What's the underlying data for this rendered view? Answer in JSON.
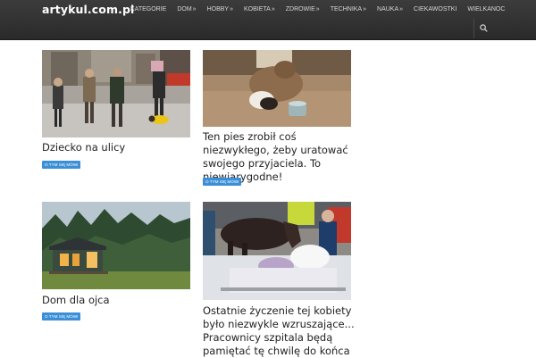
{
  "site": {
    "logo": "artykul.com.pl"
  },
  "nav": [
    {
      "label": "Kategorie",
      "chevron": false
    },
    {
      "label": "Dom",
      "chevron": true
    },
    {
      "label": "Hobby",
      "chevron": true
    },
    {
      "label": "Kobieta",
      "chevron": true
    },
    {
      "label": "Zdrowie",
      "chevron": true
    },
    {
      "label": "Technika",
      "chevron": true
    },
    {
      "label": "Nauka",
      "chevron": true
    },
    {
      "label": "Ciekawostki",
      "chevron": false
    },
    {
      "label": "Wielkanoc",
      "chevron": false
    }
  ],
  "nav_chevron": "»",
  "search": {
    "icon": "search-icon"
  },
  "articles": [
    {
      "title": "Dziecko na ulicy",
      "badge": "O tym się mówi",
      "image": "street-scene-child"
    },
    {
      "title": "Ten pies zrobił coś niezwykłego, żeby uratować swojego przyjaciela. To niewiarygodne!",
      "badge": "O tym się mówi",
      "image": "dogs-and-bucket"
    },
    {
      "title": "Dom dla ojca",
      "badge": "O tym się mówi",
      "image": "cabin-in-forest"
    },
    {
      "title": "Ostatnie życzenie tej kobiety było niezwykle wzruszające... Pracownicy szpitala będą pamiętać tę chwilę do końca",
      "badge": "",
      "image": "horse-at-hospital-bed"
    }
  ],
  "colors": {
    "header": "#2f2f2f",
    "badge": "#3b8fd6",
    "text": "#222222"
  }
}
